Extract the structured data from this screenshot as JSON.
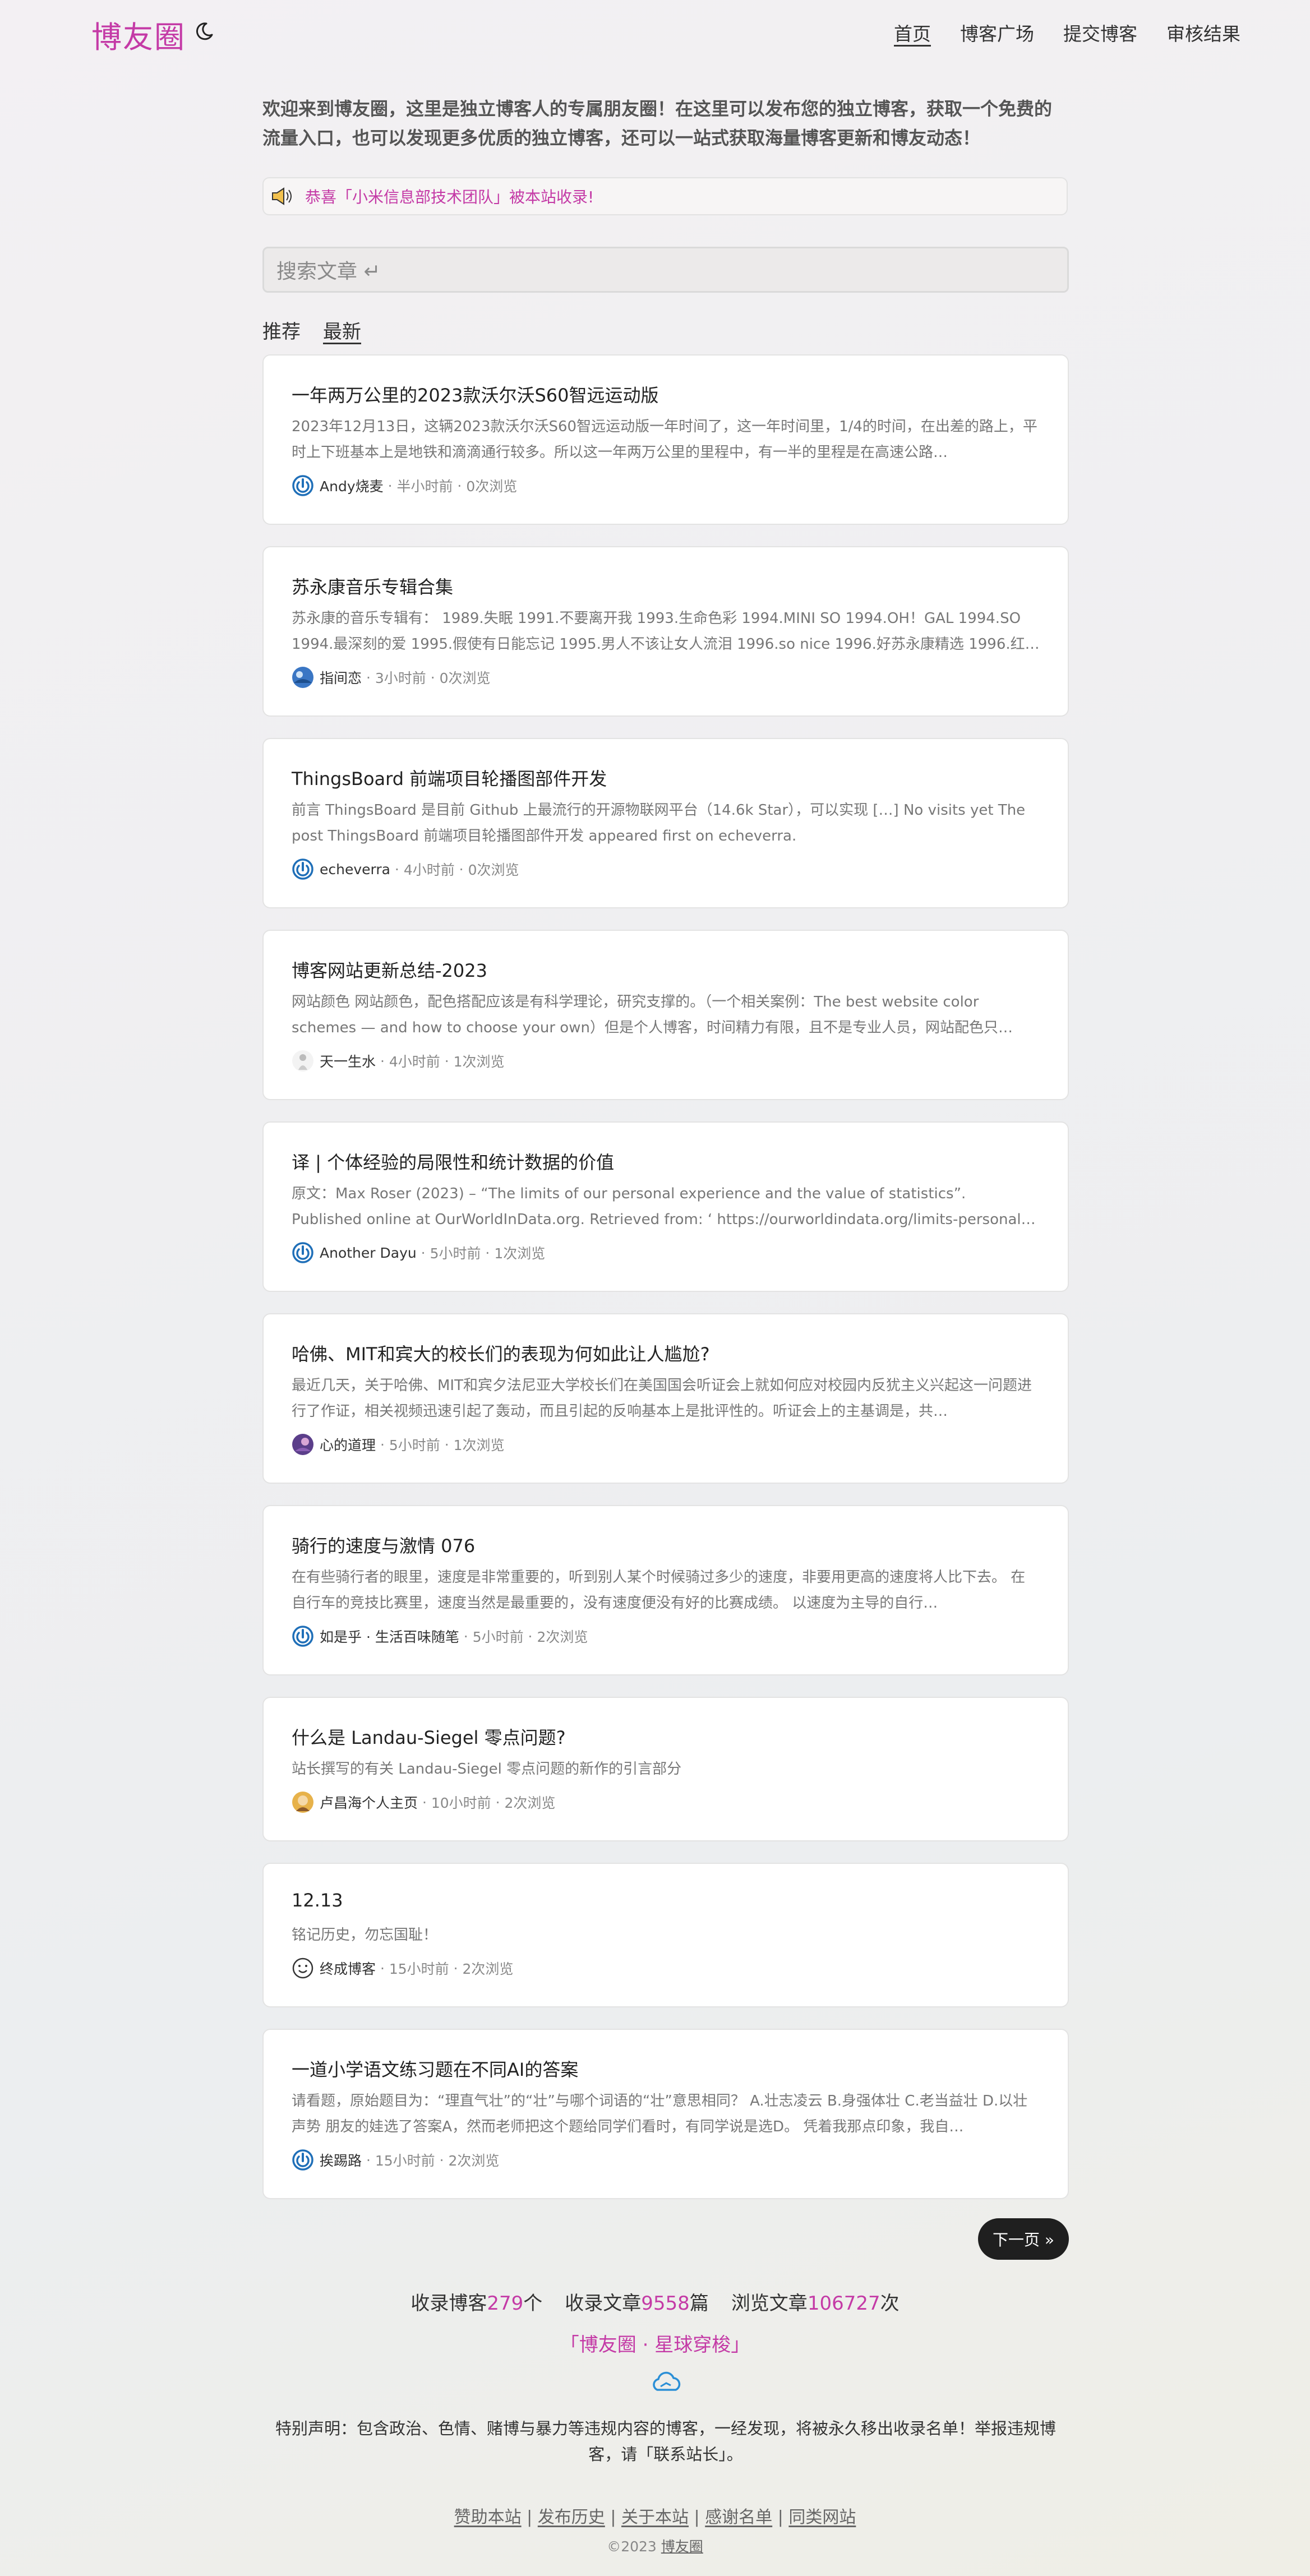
{
  "header": {
    "logo": "博友圈",
    "nav": [
      "首页",
      "博客广场",
      "提交博客",
      "审核结果"
    ]
  },
  "intro": "欢迎来到博友圈，这里是独立博客人的专属朋友圈！在这里可以发布您的独立博客，获取一个免费的流量入口，也可以发现更多优质的独立博客，还可以一站式获取海量博客更新和博友动态！",
  "notice": "恭喜「小米信息部技术团队」被本站收录!",
  "search": {
    "placeholder": "搜索文章 ↵"
  },
  "tabs": [
    "推荐",
    "最新"
  ],
  "posts": [
    {
      "title": "一年两万公里的2023款沃尔沃S60智远运动版",
      "desc": "2023年12月13日，这辆2023款沃尔沃S60智远运动版一年时间了，这一年时间里，1/4的时间，在出差的路上，平时上下班基本上是地铁和滴滴通行较多。所以这一年两万公里的里程中，有一半的里程是在高速公路…",
      "author": "Andy烧麦",
      "time": "半小时前",
      "views": "0次浏览",
      "avatar": "power-icon"
    },
    {
      "title": "苏永康音乐专辑合集",
      "desc": "苏永康的音乐专辑有： 1989.失眠 1991.不要离开我 1993.生命色彩 1994.MINI SO 1994.OH！GAL 1994.SO 1994.最深刻的爱 1995.假使有日能忘记 1995.男人不该让女人流泪 1996.so nice 1996.好苏永康精选 1996.红…",
      "author": "指间恋",
      "time": "3小时前",
      "views": "0次浏览",
      "avatar": "photo-avatar"
    },
    {
      "title": "ThingsBoard 前端项目轮播图部件开发",
      "desc": "前言 ThingsBoard 是目前 Github 上最流行的开源物联网平台（14.6k Star），可以实现 […] No visits yet The post ThingsBoard 前端项目轮播图部件开发 appeared first on echeverra.",
      "author": "echeverra",
      "time": "4小时前",
      "views": "0次浏览",
      "avatar": "power-icon"
    },
    {
      "title": "博客网站更新总结-2023",
      "desc": "网站颜色 网站颜色，配色搭配应该是有科学理论，研究支撑的。（一个相关案例：The best website color schemes — and how to choose your own）但是个人博客，时间精力有限，且不是专业人员，网站配色只…",
      "author": "天一生水",
      "time": "4小时前",
      "views": "1次浏览",
      "avatar": "person-avatar"
    },
    {
      "title": "译 | 个体经验的局限性和统计数据的价值",
      "desc": "原文：Max Roser (2023) – “The limits of our personal experience and the value of statistics”. Published online at OurWorldInData.org. Retrieved from: ‘ https://ourworldindata.org/limits-personal-experience ’…",
      "author": "Another Dayu",
      "time": "5小时前",
      "views": "1次浏览",
      "avatar": "power-icon"
    },
    {
      "title": "哈佛、MIT和宾大的校长们的表现为何如此让人尴尬?",
      "desc": "最近几天，关于哈佛、MIT和宾夕法尼亚大学校长们在美国国会听证会上就如何应对校园内反犹主义兴起这一问题进行了作证，相关视频迅速引起了轰动，而且引起的反响基本上是批评性的。听证会上的主基调是，共…",
      "author": "心的道理",
      "time": "5小时前",
      "views": "1次浏览",
      "avatar": "purple-avatar"
    },
    {
      "title": "骑行的速度与激情 076",
      "desc": "在有些骑行者的眼里，速度是非常重要的，听到别人某个时候骑过多少的速度，非要用更高的速度将人比下去。 在自行车的竞技比赛里，速度当然是最重要的，没有速度便没有好的比赛成绩。 以速度为主导的自行…",
      "author": "如是乎 · 生活百味随笔",
      "time": "5小时前",
      "views": "2次浏览",
      "avatar": "power-icon"
    },
    {
      "title": "什么是 Landau-Siegel 零点问题?",
      "desc": "站长撰写的有关 Landau-Siegel 零点问题的新作的引言部分",
      "author": "卢昌海个人主页",
      "time": "10小时前",
      "views": "2次浏览",
      "avatar": "face-avatar"
    },
    {
      "title": "12.13",
      "desc": "铭记历史，勿忘国耻！",
      "author": "终成博客",
      "time": "15小时前",
      "views": "2次浏览",
      "avatar": "smiley-icon"
    },
    {
      "title": "一道小学语文练习题在不同AI的答案",
      "desc": "请看题，原始题目为：“理直气壮”的“壮”与哪个词语的“壮”意思相同？ A.壮志凌云 B.身强体壮 C.老当益壮 D.以壮声势 朋友的娃选了答案A，然而老师把这个题给同学们看时，有同学说是选D。 凭着我那点印象，我自…",
      "author": "挨踢路",
      "time": "15小时前",
      "views": "2次浏览",
      "avatar": "power-icon"
    }
  ],
  "next_button": "下一页 »",
  "stats": {
    "blogs_label": "收录博客",
    "blogs": "279",
    "blogs_unit": "个",
    "articles_label": "收录文章",
    "articles": "9558",
    "articles_unit": "篇",
    "views_label": "浏览文章",
    "views": "106727",
    "views_unit": "次"
  },
  "galaxy": "「博友圈 · 星球穿梭」",
  "disclaimer": "特别声明：包含政治、色情、赌博与暴力等违规内容的博客，一经发现，将被永久移出收录名单！举报违规博客，请「联系站长」。",
  "footer_links": [
    "赞助本站",
    "发布历史",
    "关于本站",
    "感谢名单",
    "同类网站"
  ],
  "copyright": {
    "year": "©2023",
    "site": "博友圈"
  },
  "colors": {
    "accent": "#c43aa6",
    "power_icon": "#1f6fb8"
  }
}
